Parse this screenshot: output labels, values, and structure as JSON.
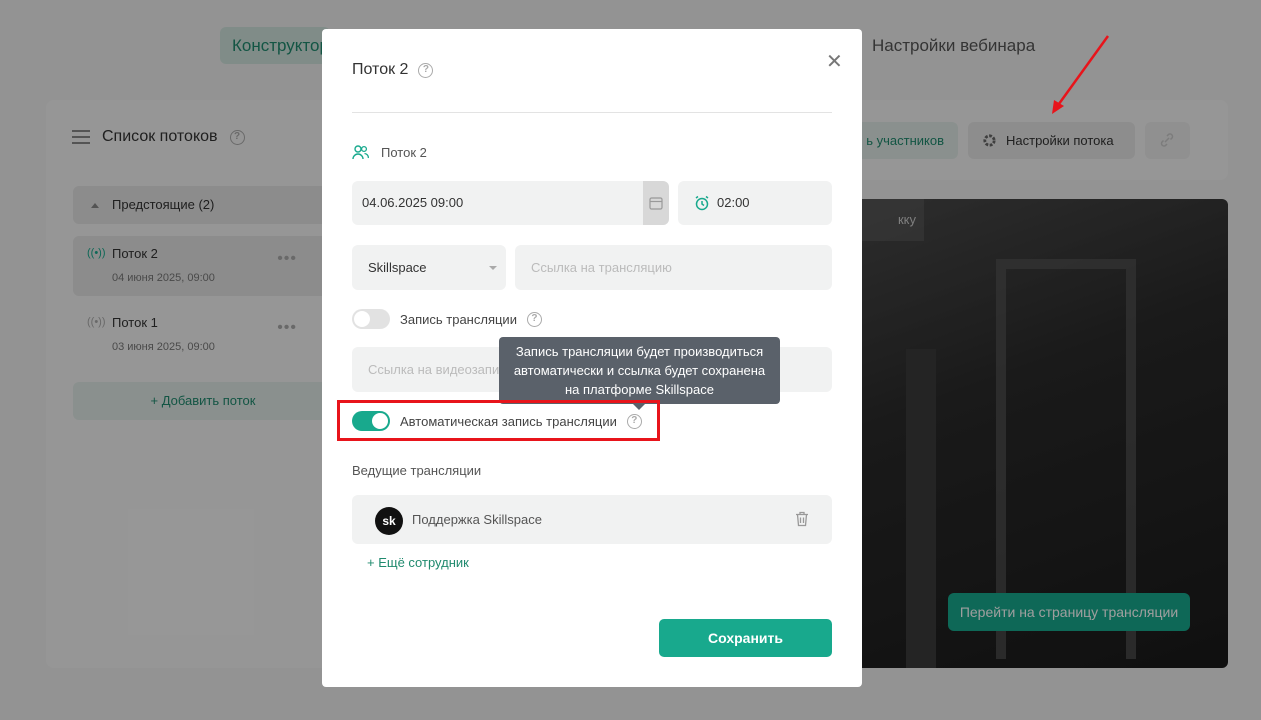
{
  "background": {
    "tabs": [
      {
        "label": "Конструктор"
      },
      {
        "label": "Настройки вебинара"
      }
    ],
    "streams_panel": {
      "title": "Список потоков",
      "group_label": "Предстоящие (2)",
      "streams": [
        {
          "name": "Поток 2",
          "date": "04 июня 2025, 09:00"
        },
        {
          "name": "Поток 1",
          "date": "03 июня 2025, 09:00"
        }
      ],
      "add_label": "+ Добавить поток"
    },
    "toolbar": {
      "participants_label": "ь участников",
      "settings_label": "Настройки потока"
    },
    "video": {
      "chip_label": "кку",
      "go_button": "Перейти на страницу трансляции"
    }
  },
  "modal": {
    "title": "Поток 2",
    "stream_name": "Поток 2",
    "date_value": "04.06.2025 09:00",
    "duration_value": "02:00",
    "platform_value": "Skillspace",
    "link_placeholder": "Ссылка на трансляцию",
    "recording_label": "Запись трансляции",
    "recording_enabled": false,
    "video_link_placeholder": "Ссылка на видеозапи",
    "tooltip": [
      "Запись трансляции будет производиться",
      "автоматически и ссылка будет сохранена",
      "на платформе Skillspace"
    ],
    "auto_recording_label": "Автоматическая запись трансляции",
    "auto_recording_enabled": true,
    "hosts_title": "Ведущие трансляции",
    "hosts": [
      {
        "avatar_text": "sk",
        "name": "Поддержка Skillspace"
      }
    ],
    "add_host_label": "+ Ещё сотрудник",
    "save_label": "Сохранить"
  },
  "colors": {
    "accent": "#18a98d",
    "highlight": "#e8141b"
  }
}
